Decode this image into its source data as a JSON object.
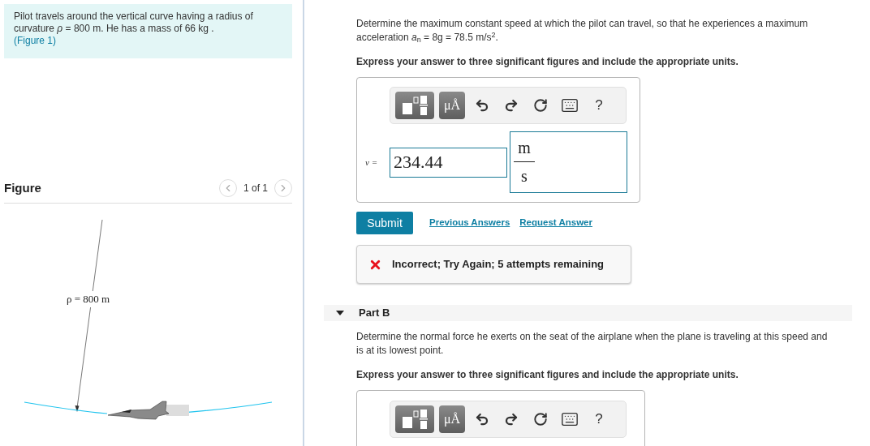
{
  "problem": {
    "text": "Pilot travels around the vertical curve having a radius of curvature *ρ* = 800 m. He has a mass of 66  kg .",
    "figure_link": "(Figure 1)"
  },
  "figure": {
    "title": "Figure",
    "pager": "1 of 1",
    "label": "ρ = 800 m"
  },
  "part_a": {
    "question": "Determine the maximum constant speed at which the pilot can travel, so that he experiences a maximum acceleration *a*$_{n}$ = 8g = 78.5 m/s$^{2}$.",
    "instruction": "Express your answer to three significant figures and include the appropriate units.",
    "toolbar": [
      {
        "kind": "template"
      },
      {
        "kind": "units",
        "label": "μÅ"
      },
      {
        "kind": "undo"
      },
      {
        "kind": "redo"
      },
      {
        "kind": "reset"
      },
      {
        "kind": "keyboard"
      },
      {
        "kind": "help",
        "label": "?"
      }
    ],
    "variable": "v =",
    "value": "234.44",
    "unit_numerator": "m",
    "unit_denominator": "s",
    "submit": "Submit",
    "links": [
      "Previous Answers",
      "Request Answer"
    ],
    "feedback": "Incorrect; Try Again; 5 attempts remaining"
  },
  "part_b": {
    "title": "Part B",
    "expanded": true,
    "question": "Determine the normal force he exerts on the seat of the airplane when the plane is traveling at this speed and is at its lowest point.",
    "instruction": "Express your answer to three significant figures and include the appropriate units.",
    "toolbar": [
      {
        "kind": "template"
      },
      {
        "kind": "units",
        "label": "μÅ"
      },
      {
        "kind": "undo"
      },
      {
        "kind": "redo"
      },
      {
        "kind": "reset"
      },
      {
        "kind": "keyboard"
      },
      {
        "kind": "help",
        "label": "?"
      }
    ]
  }
}
